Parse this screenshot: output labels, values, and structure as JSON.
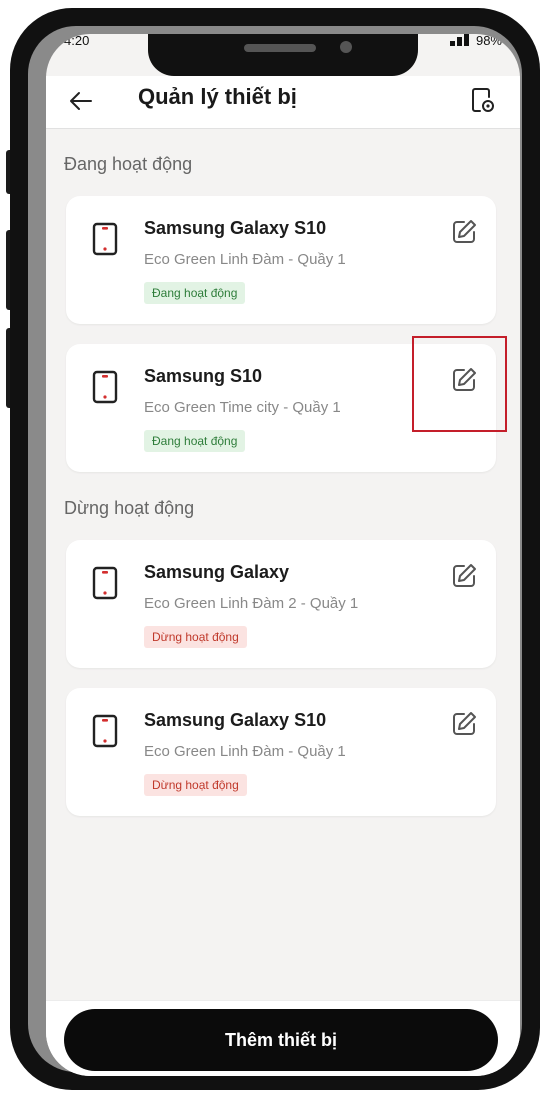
{
  "status_bar": {
    "time": "4:20",
    "battery": "98%"
  },
  "header": {
    "title": "Quản lý thiết bị",
    "back_icon": "arrow-left-icon",
    "manage_icon": "device-settings-icon"
  },
  "sections": [
    {
      "title": "Đang hoạt động",
      "devices": [
        {
          "name": "Samsung Galaxy S10",
          "location": "Eco Green Linh Đàm - Quầy 1",
          "status": "Đang hoạt động"
        },
        {
          "name": "Samsung S10",
          "location": "Eco Green Time city - Quầy 1",
          "status": "Đang hoạt động"
        }
      ]
    },
    {
      "title": "Dừng hoạt động",
      "devices": [
        {
          "name": "Samsung Galaxy",
          "location": "Eco Green Linh Đàm 2 - Quầy 1",
          "status": "Dừng hoạt động"
        },
        {
          "name": "Samsung Galaxy S10",
          "location": "Eco Green Linh Đàm - Quầy 1",
          "status": "Dừng hoạt động"
        }
      ]
    }
  ],
  "actions": {
    "add_device": "Thêm thiết bị"
  },
  "colors": {
    "accent_red": "#d32f2f",
    "active_badge_bg": "#e2f3e4",
    "active_badge_text": "#2e7d3a",
    "inactive_badge_bg": "#fbe3e1",
    "inactive_badge_text": "#c0392b",
    "highlight": "#c41e2a"
  }
}
